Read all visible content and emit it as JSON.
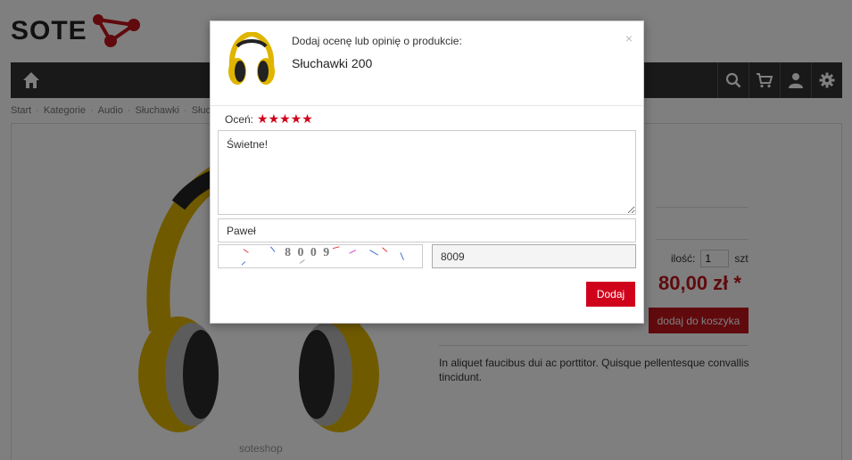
{
  "header": {
    "logo_text": "SOTE"
  },
  "navbar": {
    "icons": [
      "home-icon",
      "search-icon",
      "cart-icon",
      "user-icon",
      "gear-icon"
    ]
  },
  "breadcrumb": [
    "Start",
    "Kategorie",
    "Audio",
    "Słuchawki",
    "Słuch"
  ],
  "product": {
    "quantity_label": "ilość:",
    "quantity_value": "1",
    "quantity_unit": "szt",
    "price": "80,00 zł *",
    "add_to_cart_label": "dodaj do koszyka",
    "description": "In aliquet faucibus dui ac porttitor. Quisque pellentesque convallis tincidunt.",
    "image_watermark": "soteshop"
  },
  "modal": {
    "subtitle": "Dodaj ocenę lub opinię o produkcie:",
    "product_name": "Słuchawki 200",
    "close_label": "×",
    "rating_label": "Oceń:",
    "rating_value": 5,
    "rating_stars": "★★★★★",
    "review_text": "Świetne!",
    "name_value": "Paweł",
    "captcha_text": "8009",
    "captcha_input_value": "8009",
    "submit_label": "Dodaj"
  },
  "colors": {
    "accent": "#c0151b",
    "navbar": "#333333",
    "star": "#d0021b"
  }
}
